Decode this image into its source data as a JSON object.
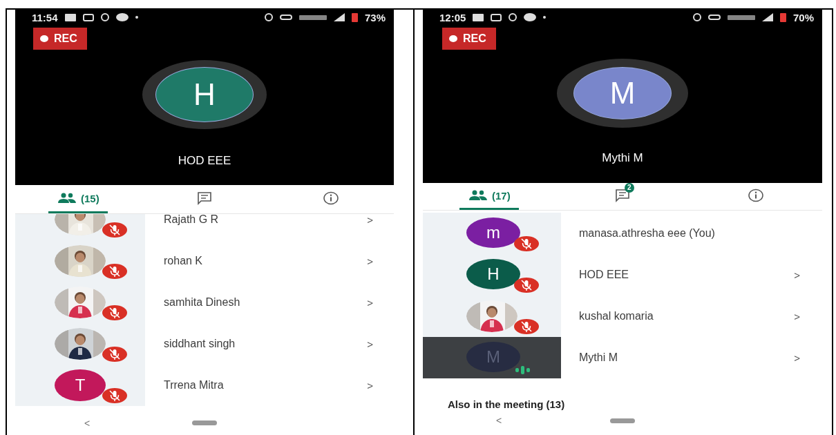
{
  "screenshots": [
    {
      "status_bar": {
        "time": "11:54",
        "battery": "73%"
      },
      "recording": "REC",
      "featured": {
        "initial": "H",
        "name": "HOD EEE",
        "color": "#1f7a68"
      },
      "tabs": [
        {
          "kind": "people",
          "label": "(15)",
          "selected": true
        },
        {
          "kind": "chat",
          "selected": false
        },
        {
          "kind": "info",
          "selected": false
        }
      ],
      "participants": [
        {
          "name": "Rajath G R",
          "muted": true,
          "speaking": false,
          "pinned": false,
          "chevron": ">"
        },
        {
          "name": "rohan K",
          "muted": true,
          "speaking": false,
          "pinned": false,
          "chevron": ">"
        },
        {
          "name": "samhita Dinesh",
          "muted": true,
          "speaking": false,
          "pinned": false,
          "chevron": ">"
        },
        {
          "name": "siddhant singh",
          "muted": true,
          "speaking": false,
          "pinned": false,
          "chevron": ">"
        },
        {
          "name": "Trrena Mitra",
          "avatar": {
            "kind": "initial",
            "letter": "T",
            "color": "#c2185b"
          },
          "muted": true,
          "speaking": false,
          "pinned": false,
          "chevron": ">"
        }
      ],
      "back": "<"
    },
    {
      "status_bar": {
        "time": "12:05",
        "battery": "70%"
      },
      "recording": "REC",
      "featured": {
        "initial": "M",
        "name": "Mythi M",
        "color": "#7986cb"
      },
      "tabs": [
        {
          "kind": "people",
          "label": "(17)",
          "selected": true
        },
        {
          "kind": "chat",
          "badge": "2",
          "selected": false
        },
        {
          "kind": "info",
          "selected": false
        }
      ],
      "participants": [
        {
          "name": "manasa.athresha eee (You)",
          "avatar": {
            "kind": "initial",
            "letter": "m",
            "color": "#7b1fa2"
          },
          "muted": true,
          "speaking": false,
          "pinned": false
        },
        {
          "name": "HOD EEE",
          "avatar": {
            "kind": "initial",
            "letter": "H",
            "color": "#0b5c4a"
          },
          "muted": true,
          "speaking": false,
          "pinned": false,
          "chevron": ">"
        },
        {
          "name": "kushal komaria",
          "muted": true,
          "speaking": false,
          "pinned": false,
          "chevron": ">"
        },
        {
          "name": "Mythi M",
          "avatar": {
            "kind": "initial",
            "letter": "M",
            "color": "#272c42"
          },
          "muted": false,
          "speaking": true,
          "pinned": true,
          "chevron": ">"
        }
      ],
      "section_heading": "Also in the meeting (13)",
      "back": "<"
    }
  ]
}
